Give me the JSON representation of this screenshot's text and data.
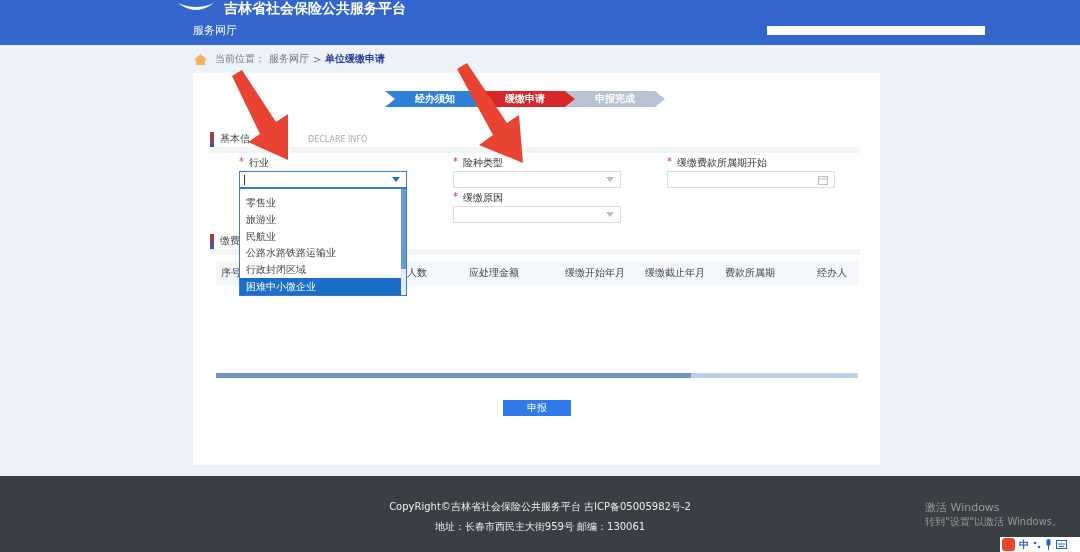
{
  "header": {
    "site_title": "吉林省社会保险公共服务平台",
    "nav": [
      {
        "label": "服务网厅",
        "selected": true
      }
    ]
  },
  "breadcrumb": {
    "prefix": "当前位置：",
    "items": [
      {
        "label": "服务网厅",
        "current": false
      },
      {
        "label": "单位缓缴申请",
        "current": true
      }
    ],
    "separator": ">"
  },
  "steps": [
    {
      "label": "经办须知",
      "color": "#2f80d8"
    },
    {
      "label": "缓缴申请",
      "color": "#d8272a"
    },
    {
      "label": "申报完成",
      "color": "#b7c3d0"
    }
  ],
  "basic_section": {
    "title": "基本信",
    "subtitle": "DECLARE INFO"
  },
  "fields": [
    {
      "label": "行业",
      "required_mark": "*",
      "kind": "select",
      "focused": true
    },
    {
      "label": "险种类型",
      "required_mark": "*",
      "kind": "select",
      "focused": false
    },
    {
      "label": "缓缴费款所属期开始",
      "required_mark": "*",
      "kind": "date",
      "focused": false
    },
    {
      "label": "缓缴原因",
      "required_mark": "*",
      "kind": "select",
      "focused": false
    }
  ],
  "dropdown": {
    "options": [
      {
        "label": "零售业",
        "selected": false
      },
      {
        "label": "旅游业",
        "selected": false
      },
      {
        "label": "民航业",
        "selected": false
      },
      {
        "label": "公路水路铁路运输业",
        "selected": false
      },
      {
        "label": "行政封闭区域",
        "selected": false
      },
      {
        "label": "困难中小微企业",
        "selected": true
      }
    ]
  },
  "fee_section": {
    "title": "缴费"
  },
  "table": {
    "columns": [
      "序号",
      "人数",
      "应处理金额",
      "缓缴开始年月",
      "缓缴截止年月",
      "费款所属期",
      "经办人"
    ]
  },
  "submit_button": "申报",
  "footer": {
    "copyright": "CopyRight©吉林省社会保险公共服务平台 吉ICP备05005982号-2",
    "address": "地址：长春市西民主大街959号 邮编：130061"
  },
  "os_watermark": {
    "title": "激活 Windows",
    "hint": "转到\"设置\"以激活 Windows。"
  },
  "ime": {
    "mode": "中"
  }
}
